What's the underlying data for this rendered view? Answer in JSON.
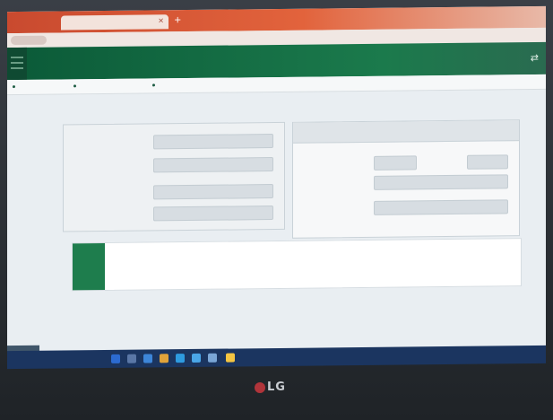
{
  "browser": {
    "tab_title": "",
    "tab_close": "×",
    "new_tab": "+"
  },
  "header": {
    "icon": "⇄"
  },
  "breadcrumb": [
    "",
    "",
    ""
  ],
  "page": {
    "title": ""
  },
  "left_panel": {
    "fields": [
      {
        "label": "",
        "value": ""
      },
      {
        "label": "",
        "value": ""
      },
      {
        "label": "",
        "value": ""
      },
      {
        "label": "",
        "value": ""
      }
    ]
  },
  "right_panel": {
    "heading": "",
    "row1": {
      "label_a": "",
      "value_a": "",
      "label_b": "",
      "value_b": ""
    },
    "fields": [
      {
        "label": "",
        "value": ""
      },
      {
        "label": "",
        "value": ""
      }
    ]
  },
  "note": {
    "badge": "",
    "line1": "",
    "line1_link": "",
    "line2": "",
    "line3": ""
  },
  "footer": {
    "line1": "",
    "line2": "",
    "line3": ""
  },
  "side_tab": "",
  "taskbar": {
    "status": ""
  },
  "monitor": {
    "brand": "LG"
  },
  "colors": {
    "brand_green": "#1e7d4d",
    "header_green": "#0b5a38",
    "browser_accent": "#c94a2f"
  }
}
